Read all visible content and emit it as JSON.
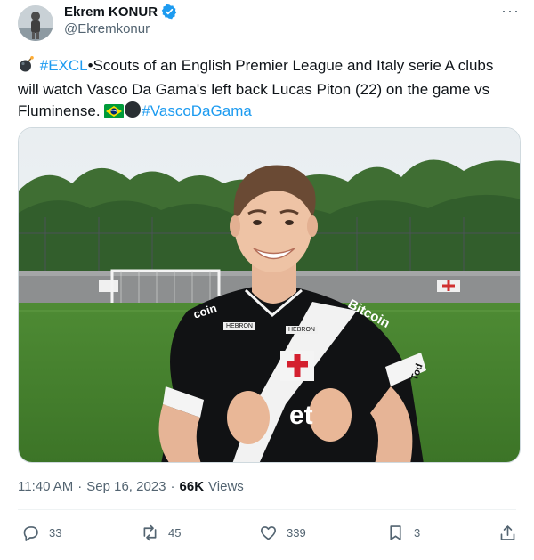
{
  "author": {
    "display_name": "Ekrem KONUR",
    "handle": "@Ekremkonur",
    "verified": true
  },
  "tweet": {
    "hashtag_1": "#EXCL",
    "body": "•Scouts of an English Premier League and  Italy serie A clubs will watch Vasco Da Gama's left back Lucas Piton (22) on the game vs Fluminense.",
    "hashtag_2": "#VascoDaGama",
    "emojis": [
      "bomb",
      "brazil-flag",
      "black-circle"
    ]
  },
  "media": {
    "jersey_texts": {
      "sponsor_main": "Bitcoin",
      "sponsor_left": "coin",
      "front_partial": "et",
      "chest_badge_left": "HEBRON",
      "chest_badge_right": "HEBRON",
      "sleeve": "Tod"
    }
  },
  "meta": {
    "time": "11:40 AM",
    "separator": "·",
    "date": "Sep 16, 2023",
    "views_count": "66K",
    "views_label": "Views"
  },
  "actions": {
    "replies": "33",
    "reposts": "45",
    "likes": "339",
    "bookmarks": "3"
  },
  "colors": {
    "accent": "#1d9bf0",
    "text": "#0f1419",
    "secondary": "#536471",
    "divider": "#eff3f4"
  }
}
